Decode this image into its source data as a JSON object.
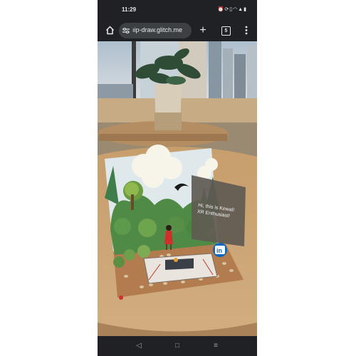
{
  "status_bar": {
    "time": "11:29"
  },
  "browser": {
    "url_text": "ıip-draw.glitch.me",
    "tab_count": "5"
  },
  "ar_scene": {
    "greeting_text": "Hi, this is Kewal! XR Enthusiast!",
    "linkedin_label": "in"
  },
  "icons": {
    "status": [
      "alarm-icon",
      "sync-icon",
      "vibrate-icon",
      "wifi-icon",
      "signal-icon",
      "battery-icon"
    ],
    "toolbar": [
      "home-icon",
      "tune-icon",
      "plus-icon",
      "tabs-icon",
      "more-vert-icon"
    ],
    "nav": [
      "back-icon",
      "home-circle-icon",
      "recents-icon"
    ]
  },
  "colors": {
    "browser_chrome": "#202124",
    "url_pill": "#3c4043",
    "linkedin_blue": "#0a66c2",
    "table_wood": "#c9a477"
  }
}
